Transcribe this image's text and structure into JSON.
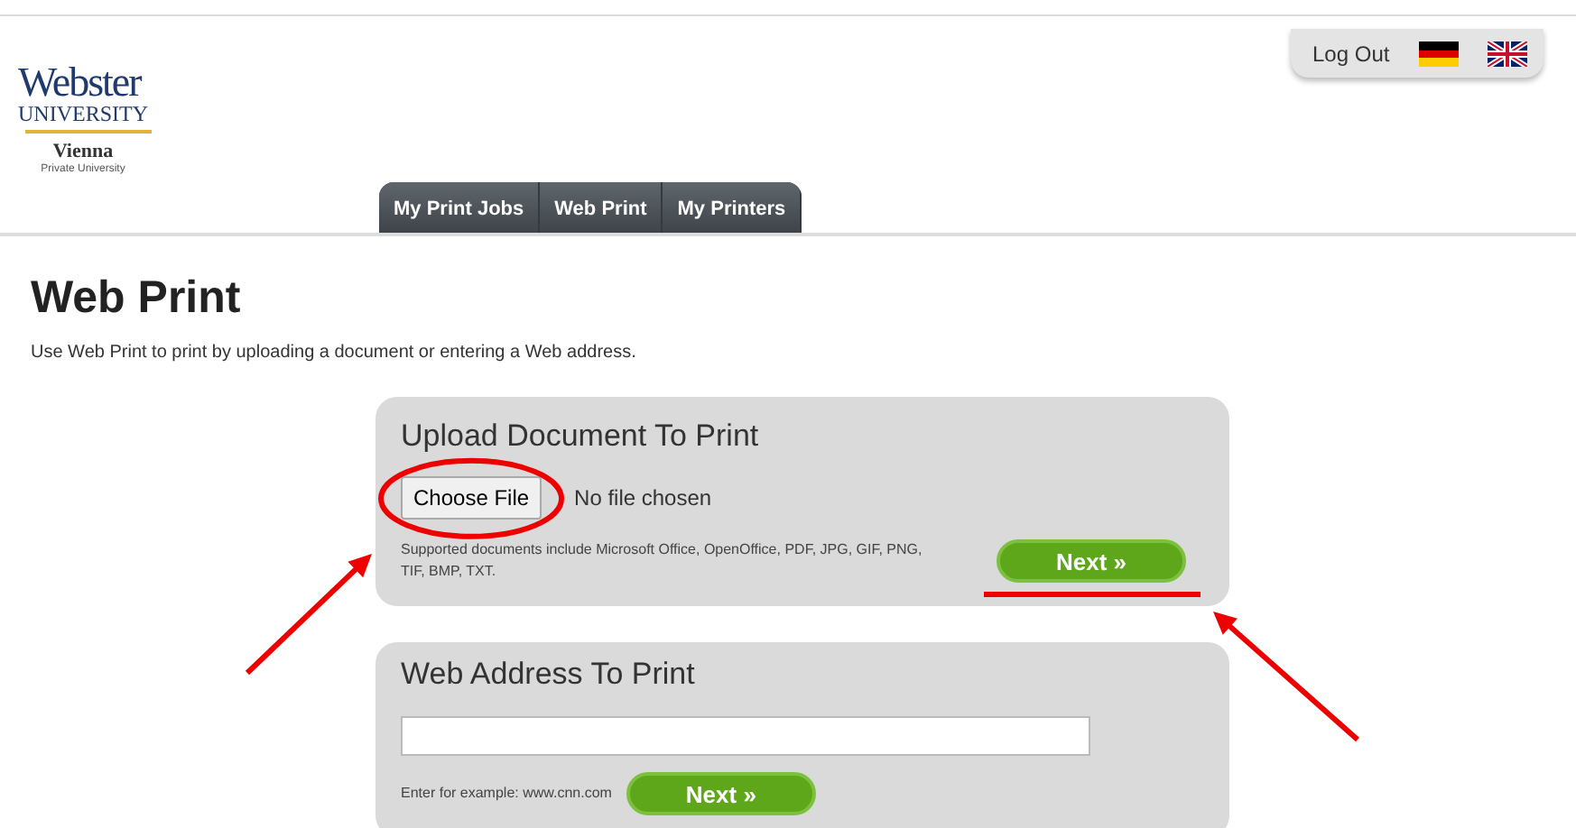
{
  "header": {
    "logo": {
      "name": "Webster",
      "line2": "UNIVERSITY",
      "campus": "Vienna",
      "tagline": "Private University"
    },
    "account": {
      "logout": "Log Out",
      "languages": [
        {
          "kind": "german",
          "selected": false
        },
        {
          "kind": "english",
          "selected": false
        }
      ]
    },
    "tabs": [
      {
        "label": "My Print Jobs",
        "selected": false
      },
      {
        "label": "Web Print",
        "selected": false
      },
      {
        "label": "My Printers",
        "selected": false
      }
    ]
  },
  "page": {
    "title": "Web Print",
    "description": "Use Web Print to print by uploading a document or entering a Web address."
  },
  "panels": [
    {
      "kind": "upload",
      "title": "Upload Document To Print",
      "button": "Choose File",
      "status": "No file chosen",
      "note": "Supported documents include Microsoft Office, OpenOffice, PDF, JPG, GIF, PNG, TIF, BMP, TXT.",
      "next": "Next »"
    },
    {
      "kind": "address",
      "title": "Web Address To Print",
      "note": "Enter for example: www.cnn.com",
      "next": "Next »"
    }
  ],
  "annotations": [
    {
      "kind": "circle"
    },
    {
      "kind": "arrow-left"
    },
    {
      "kind": "underline"
    },
    {
      "kind": "arrow-right"
    }
  ]
}
